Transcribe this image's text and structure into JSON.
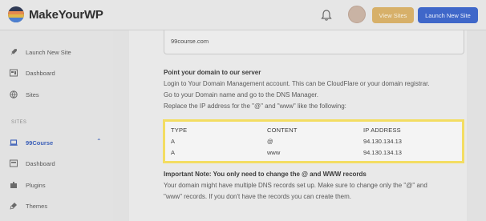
{
  "brand": {
    "name": "MakeYourWP"
  },
  "header": {
    "view_sites_label": "View Sites",
    "launch_new_site_label": "Launch New Site"
  },
  "sidebar": {
    "items": [
      {
        "label": "Launch New Site",
        "icon": "rocket-icon"
      },
      {
        "label": "Dashboard",
        "icon": "dashboard-icon"
      },
      {
        "label": "Sites",
        "icon": "globe-icon"
      }
    ],
    "section_label": "SITES",
    "site": {
      "label": "99Course",
      "icon": "laptop-icon",
      "expanded": true
    },
    "site_items": [
      {
        "label": "Dashboard",
        "icon": "dashboard-icon"
      },
      {
        "label": "Plugins",
        "icon": "plugin-icon"
      },
      {
        "label": "Themes",
        "icon": "brush-icon"
      }
    ]
  },
  "main": {
    "domain_value": "99course.com",
    "point_heading": "Point your domain to our server",
    "instructions": [
      "Login to Your Domain Management account. This can be CloudFlare or your domain registrar.",
      "Go to your Domain name and go to the DNS Manager.",
      "Replace the IP address for the \"@\" and \"www\" like the following:"
    ],
    "dns_table": {
      "headers": [
        "TYPE",
        "CONTENT",
        "IP ADDRESS"
      ],
      "rows": [
        [
          "A",
          "@",
          "94.130.134.13"
        ],
        [
          "A",
          "www",
          "94.130.134.13"
        ]
      ]
    },
    "note_heading": "Important Note: You only need to change the @ and WWW records",
    "note_body": [
      "Your domain might have multiple DNS records set up. Make sure to change only the \"@\" and",
      "\"www\" records. If you don't have the records you can create them."
    ]
  },
  "colors": {
    "highlight_border": "#f3dd62",
    "accent_blue": "#3f67c9",
    "accent_gold": "#d7b069"
  }
}
